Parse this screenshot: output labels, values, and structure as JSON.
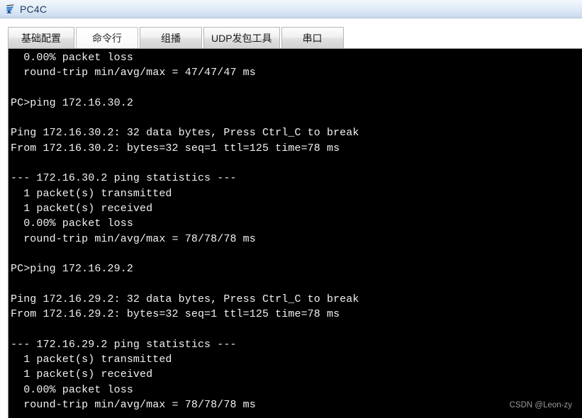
{
  "window": {
    "title": "PC4C",
    "icon": "pc-device-icon"
  },
  "tabs": [
    {
      "label": "基础配置",
      "active": false,
      "name": "tab-basic-config"
    },
    {
      "label": "命令行",
      "active": true,
      "name": "tab-command-line"
    },
    {
      "label": "组播",
      "active": false,
      "name": "tab-multicast"
    },
    {
      "label": "UDP发包工具",
      "active": false,
      "name": "tab-udp-tool"
    },
    {
      "label": "串口",
      "active": false,
      "name": "tab-serial-port"
    }
  ],
  "terminal": {
    "text": "  0.00% packet loss\n  round-trip min/avg/max = 47/47/47 ms\n\nPC>ping 172.16.30.2\n\nPing 172.16.30.2: 32 data bytes, Press Ctrl_C to break\nFrom 172.16.30.2: bytes=32 seq=1 ttl=125 time=78 ms\n\n--- 172.16.30.2 ping statistics ---\n  1 packet(s) transmitted\n  1 packet(s) received\n  0.00% packet loss\n  round-trip min/avg/max = 78/78/78 ms\n\nPC>ping 172.16.29.2\n\nPing 172.16.29.2: 32 data bytes, Press Ctrl_C to break\nFrom 172.16.29.2: bytes=32 seq=1 ttl=125 time=78 ms\n\n--- 172.16.29.2 ping statistics ---\n  1 packet(s) transmitted\n  1 packet(s) received\n  0.00% packet loss\n  round-trip min/avg/max = 78/78/78 ms",
    "background_color": "#000000",
    "text_color": "#f2f2f2"
  },
  "watermark": {
    "text": "CSDN @Leon-zy",
    "color": "#9a9a9a"
  }
}
